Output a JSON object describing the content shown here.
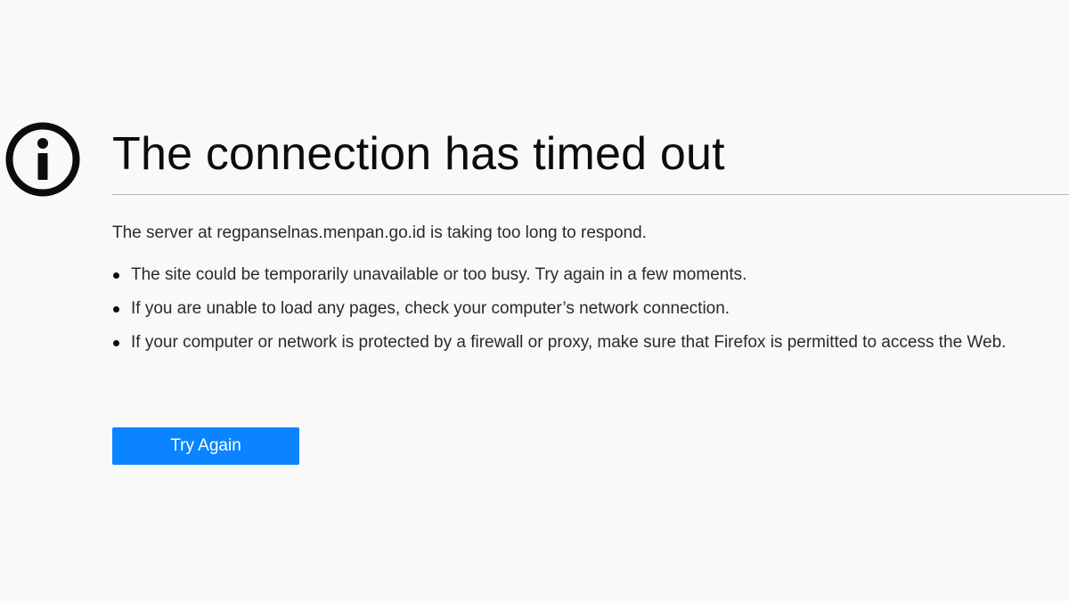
{
  "error_page": {
    "icon": "info-icon",
    "title": "The connection has timed out",
    "intro": "The server at regpanselnas.menpan.go.id is taking too long to respond.",
    "reasons": [
      "The site could be temporarily unavailable or too busy. Try again in a few moments.",
      "If you are unable to load any pages, check your computer’s network connection.",
      "If your computer or network is protected by a firewall or proxy, make sure that Firefox is permitted to access the Web."
    ],
    "try_again_label": "Try Again"
  },
  "colors": {
    "background": "#f9f9fa",
    "button": "#0a84ff",
    "text": "#0c0c0d"
  }
}
